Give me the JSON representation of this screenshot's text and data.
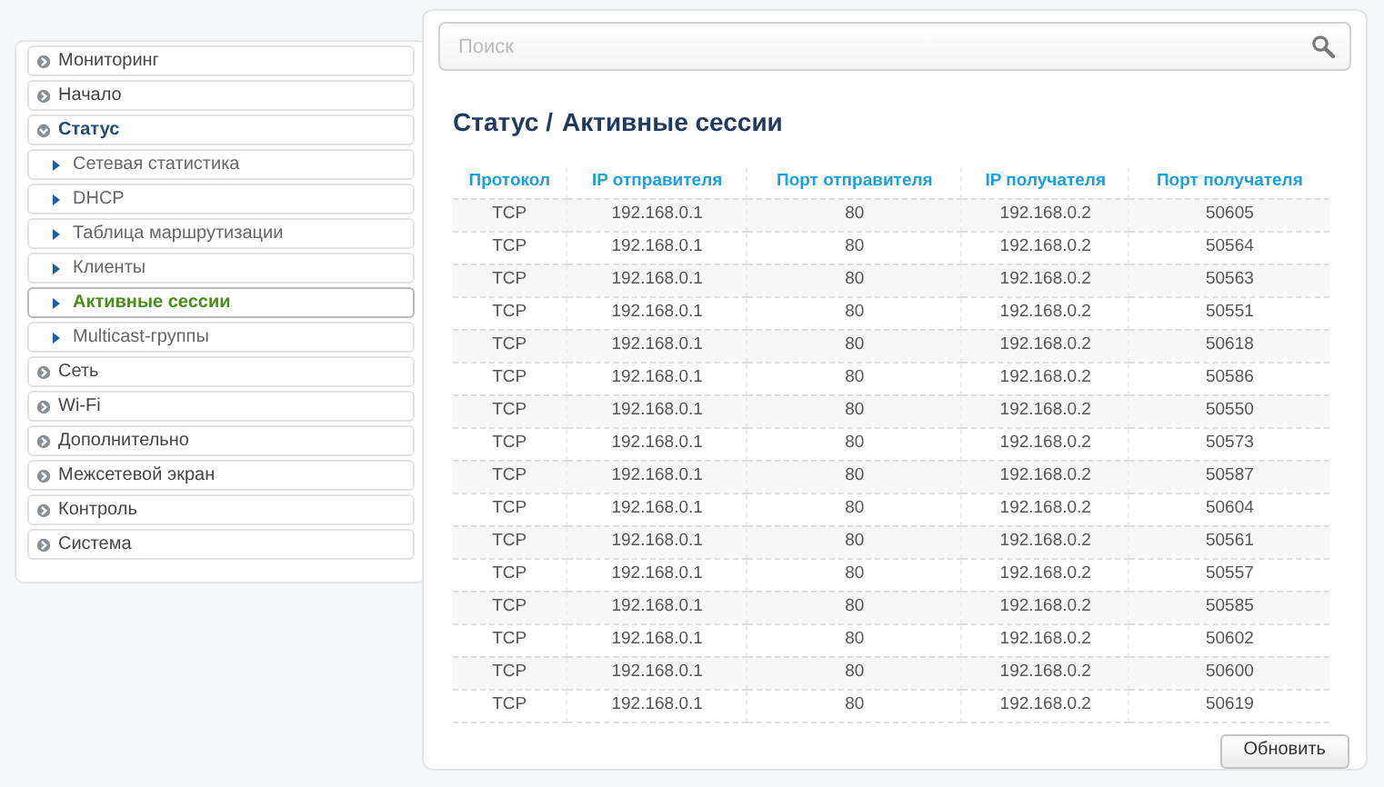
{
  "sidebar": {
    "items": [
      {
        "label": "Мониторинг",
        "expanded": false
      },
      {
        "label": "Начало",
        "expanded": false
      },
      {
        "label": "Статус",
        "expanded": true,
        "children": [
          {
            "label": "Сетевая статистика",
            "selected": false
          },
          {
            "label": "DHCP",
            "selected": false
          },
          {
            "label": "Таблица маршрутизации",
            "selected": false
          },
          {
            "label": "Клиенты",
            "selected": false
          },
          {
            "label": "Активные сессии",
            "selected": true
          },
          {
            "label": "Multicast-группы",
            "selected": false
          }
        ]
      },
      {
        "label": "Сеть",
        "expanded": false
      },
      {
        "label": "Wi-Fi",
        "expanded": false
      },
      {
        "label": "Дополнительно",
        "expanded": false
      },
      {
        "label": "Межсетевой экран",
        "expanded": false
      },
      {
        "label": "Контроль",
        "expanded": false
      },
      {
        "label": "Система",
        "expanded": false
      }
    ]
  },
  "search": {
    "placeholder": "Поиск"
  },
  "breadcrumb": {
    "parent": "Статус /",
    "current": "Активные сессии"
  },
  "table": {
    "columns": [
      "Протокол",
      "IP отправителя",
      "Порт отправителя",
      "IP получателя",
      "Порт получателя"
    ],
    "rows": [
      [
        "TCP",
        "192.168.0.1",
        "80",
        "192.168.0.2",
        "50605"
      ],
      [
        "TCP",
        "192.168.0.1",
        "80",
        "192.168.0.2",
        "50564"
      ],
      [
        "TCP",
        "192.168.0.1",
        "80",
        "192.168.0.2",
        "50563"
      ],
      [
        "TCP",
        "192.168.0.1",
        "80",
        "192.168.0.2",
        "50551"
      ],
      [
        "TCP",
        "192.168.0.1",
        "80",
        "192.168.0.2",
        "50618"
      ],
      [
        "TCP",
        "192.168.0.1",
        "80",
        "192.168.0.2",
        "50586"
      ],
      [
        "TCP",
        "192.168.0.1",
        "80",
        "192.168.0.2",
        "50550"
      ],
      [
        "TCP",
        "192.168.0.1",
        "80",
        "192.168.0.2",
        "50573"
      ],
      [
        "TCP",
        "192.168.0.1",
        "80",
        "192.168.0.2",
        "50587"
      ],
      [
        "TCP",
        "192.168.0.1",
        "80",
        "192.168.0.2",
        "50604"
      ],
      [
        "TCP",
        "192.168.0.1",
        "80",
        "192.168.0.2",
        "50561"
      ],
      [
        "TCP",
        "192.168.0.1",
        "80",
        "192.168.0.2",
        "50557"
      ],
      [
        "TCP",
        "192.168.0.1",
        "80",
        "192.168.0.2",
        "50585"
      ],
      [
        "TCP",
        "192.168.0.1",
        "80",
        "192.168.0.2",
        "50602"
      ],
      [
        "TCP",
        "192.168.0.1",
        "80",
        "192.168.0.2",
        "50600"
      ],
      [
        "TCP",
        "192.168.0.1",
        "80",
        "192.168.0.2",
        "50619"
      ]
    ]
  },
  "refresh_button": "Обновить"
}
